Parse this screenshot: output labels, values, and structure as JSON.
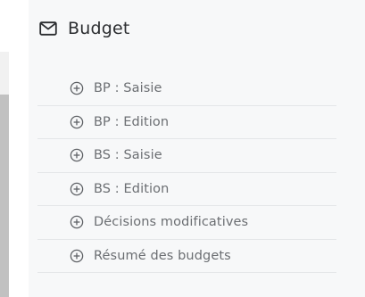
{
  "section": {
    "title": "Budget",
    "icon": "envelope-icon"
  },
  "menu": {
    "item_icon": "plus-circle-icon",
    "items": [
      {
        "label": "BP : Saisie"
      },
      {
        "label": "BP : Edition"
      },
      {
        "label": "BS : Saisie"
      },
      {
        "label": "BS : Edition"
      },
      {
        "label": "Décisions modificatives"
      },
      {
        "label": "Résumé des budgets"
      }
    ]
  },
  "colors": {
    "panel_background": "#f7f8f9",
    "header_text": "#2b2d30",
    "item_text": "#6b6e72",
    "divider": "#e4e6e9",
    "scrollbar_thumb": "#c1c1c1"
  }
}
